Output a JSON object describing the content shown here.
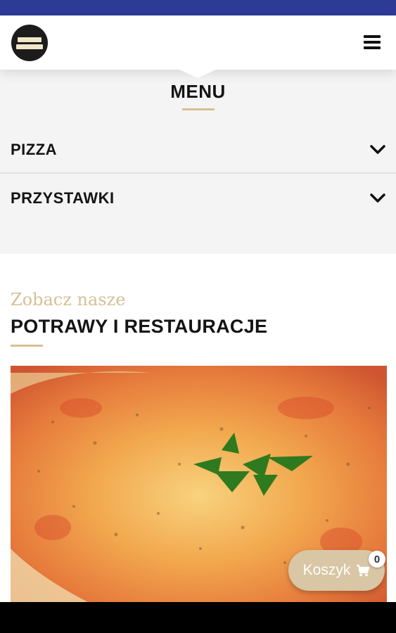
{
  "header": {
    "logo_alt": "restaurant-logo",
    "menu_icon": "hamburger-menu-icon"
  },
  "menu": {
    "title": "MENU",
    "categories": [
      {
        "label": "PIZZA",
        "icon": "chevron-down-icon"
      },
      {
        "label": "PRZYSTAWKI",
        "icon": "chevron-down-icon"
      }
    ]
  },
  "restaurants": {
    "subtitle": "Zobacz nasze",
    "title": "POTRAWY I RESTAURACJE",
    "image": "pizza-photo"
  },
  "cart": {
    "label": "Koszyk",
    "count": "0",
    "icon": "shopping-cart-icon"
  },
  "colors": {
    "status_bar": "#2d3a96",
    "accent_gold": "#d8bf91",
    "cart_button": "#d9c6a4",
    "menu_background": "#f4f4f4"
  }
}
